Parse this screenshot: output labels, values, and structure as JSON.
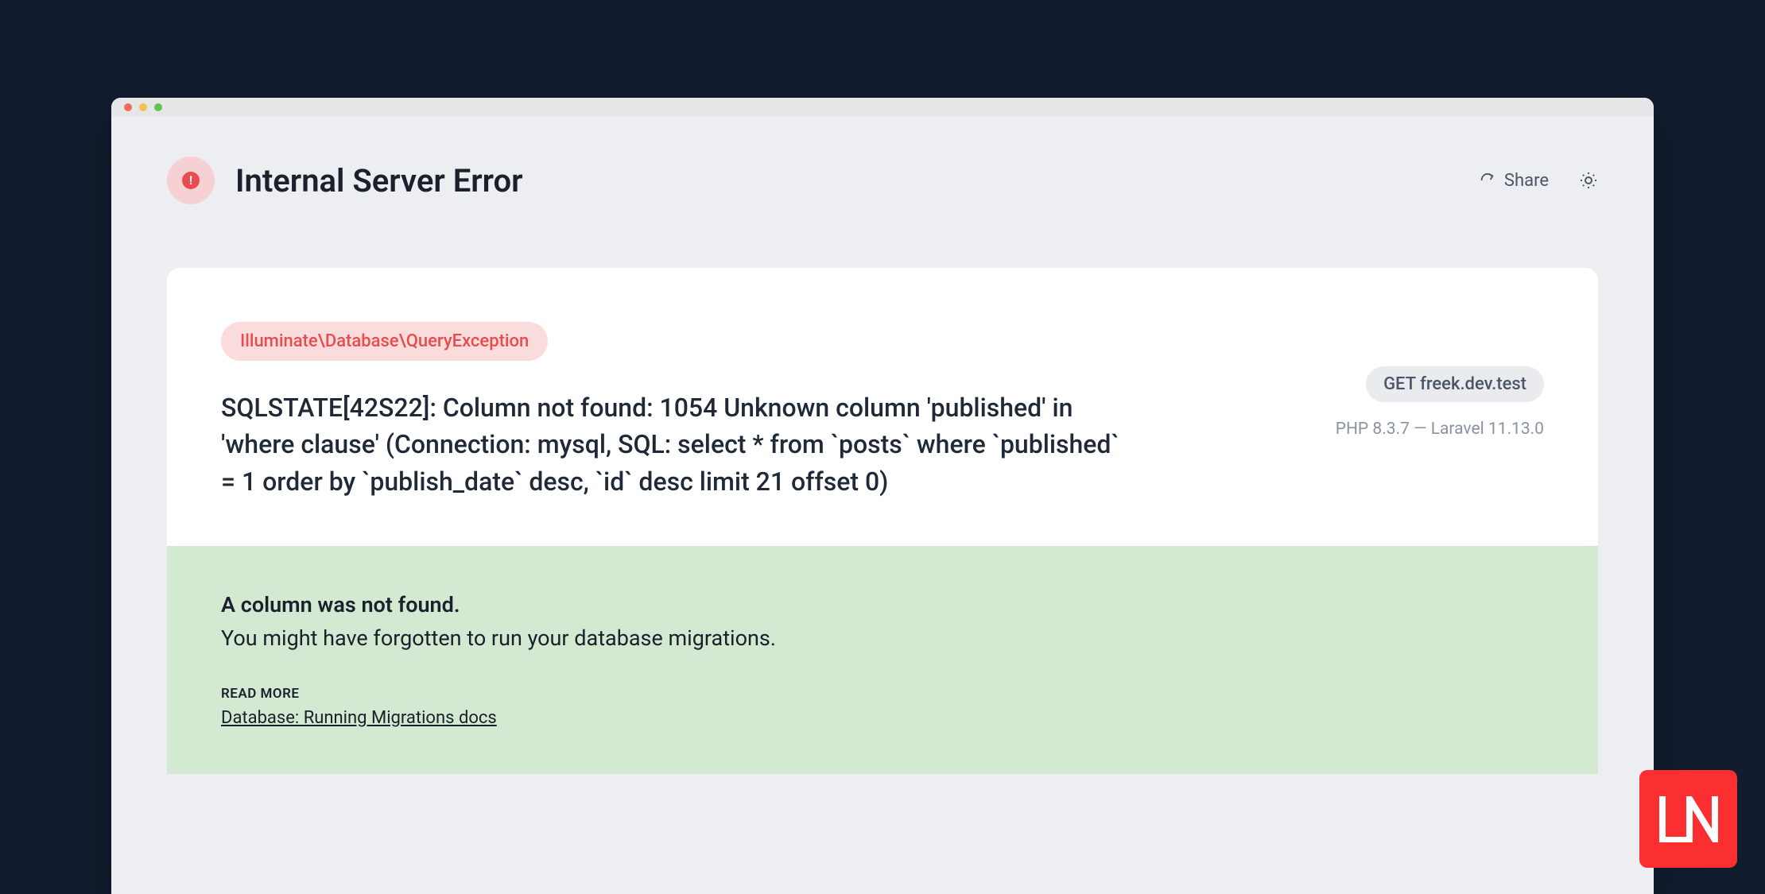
{
  "header": {
    "title": "Internal Server Error",
    "share_label": "Share"
  },
  "exception": {
    "class": "Illuminate\\Database\\QueryException",
    "message": "SQLSTATE[42S22]: Column not found: 1054 Unknown column 'published' in 'where clause' (Connection: mysql, SQL: select * from `posts` where `published` = 1 order by `publish_date` desc, `id` desc limit 21 offset 0)"
  },
  "request": {
    "method": "GET",
    "host": "freek.dev.test"
  },
  "versions": {
    "php": "PHP 8.3.7",
    "separator": " — ",
    "laravel": "Laravel 11.13.0"
  },
  "hint": {
    "title": "A column was not found.",
    "text": "You might have forgotten to run your database migrations.",
    "read_more_label": "READ MORE",
    "docs_link_text": "Database: Running Migrations docs"
  },
  "logo": {
    "text": "LN"
  }
}
